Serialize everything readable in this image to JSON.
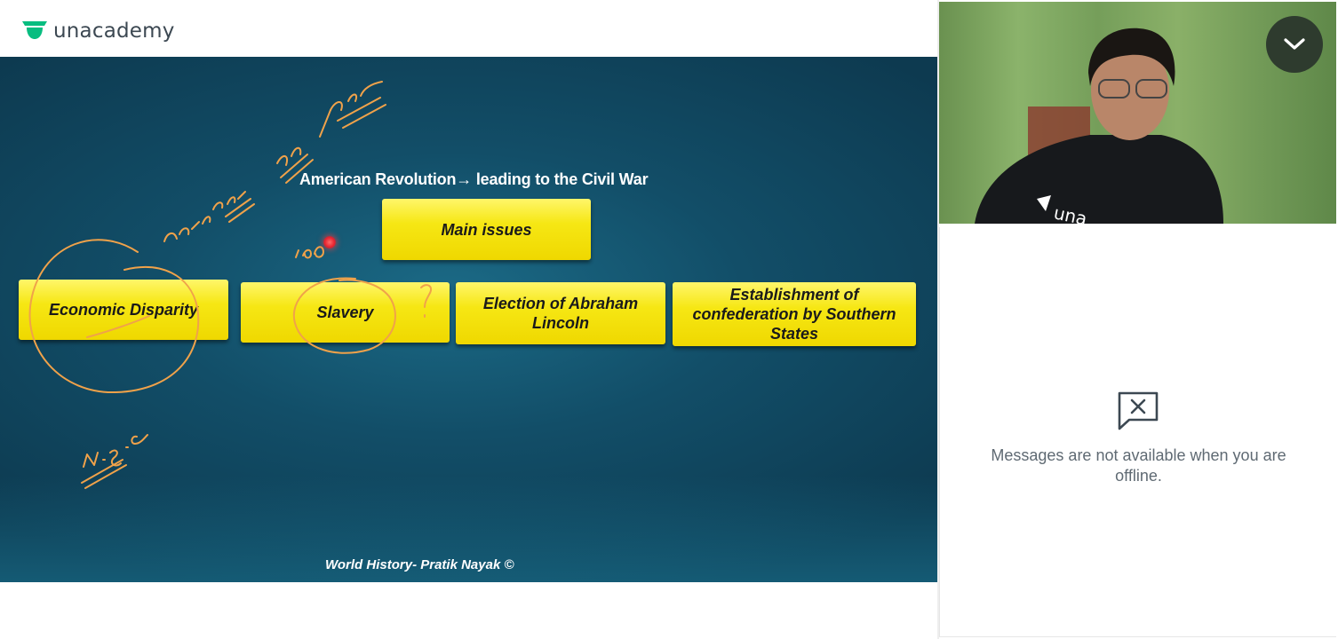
{
  "brand": {
    "name": "unacademy",
    "accent": "#08bd80"
  },
  "slide": {
    "title": "American Revolution→ leading to the Civil War",
    "main_box": "Main issues",
    "issues": [
      {
        "label": "Economic Disparity"
      },
      {
        "label": "Slavery"
      },
      {
        "label": "Election of Abraham Lincoln"
      },
      {
        "label": "Establishment of confederation by Southern States"
      }
    ],
    "footer": "World History- Pratik Nayak ©",
    "box_color": "#f4e40c",
    "ink_color": "#f0a24a"
  },
  "video": {
    "collapse_icon": "chevron-down-icon"
  },
  "chat": {
    "offline_icon": "message-off-icon",
    "offline_message": "Messages are not available when you are offline."
  }
}
